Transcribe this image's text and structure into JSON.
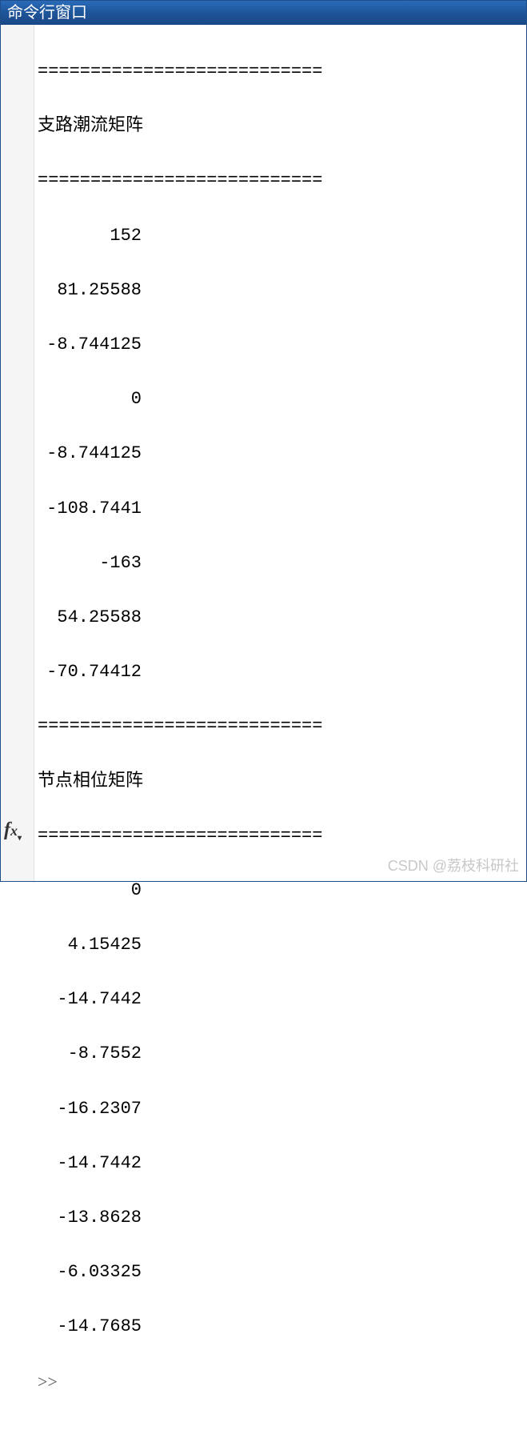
{
  "window": {
    "title": "命令行窗口"
  },
  "output": {
    "divider": "===========================",
    "section1_title": "支路潮流矩阵",
    "section1_values": [
      "152",
      "81.25588",
      "-8.744125",
      "0",
      "-8.744125",
      "-108.7441",
      "-163",
      "54.25588",
      "-70.74412"
    ],
    "section2_title": "节点相位矩阵",
    "section2_values": [
      "0",
      "4.15425",
      "-14.7442",
      "-8.7552",
      "-16.2307",
      "-14.7442",
      "-13.8628",
      "-6.03325",
      "-14.7685"
    ],
    "prompt": ">>"
  },
  "icons": {
    "fx": "fx"
  },
  "watermark": "CSDN @荔枝科研社"
}
